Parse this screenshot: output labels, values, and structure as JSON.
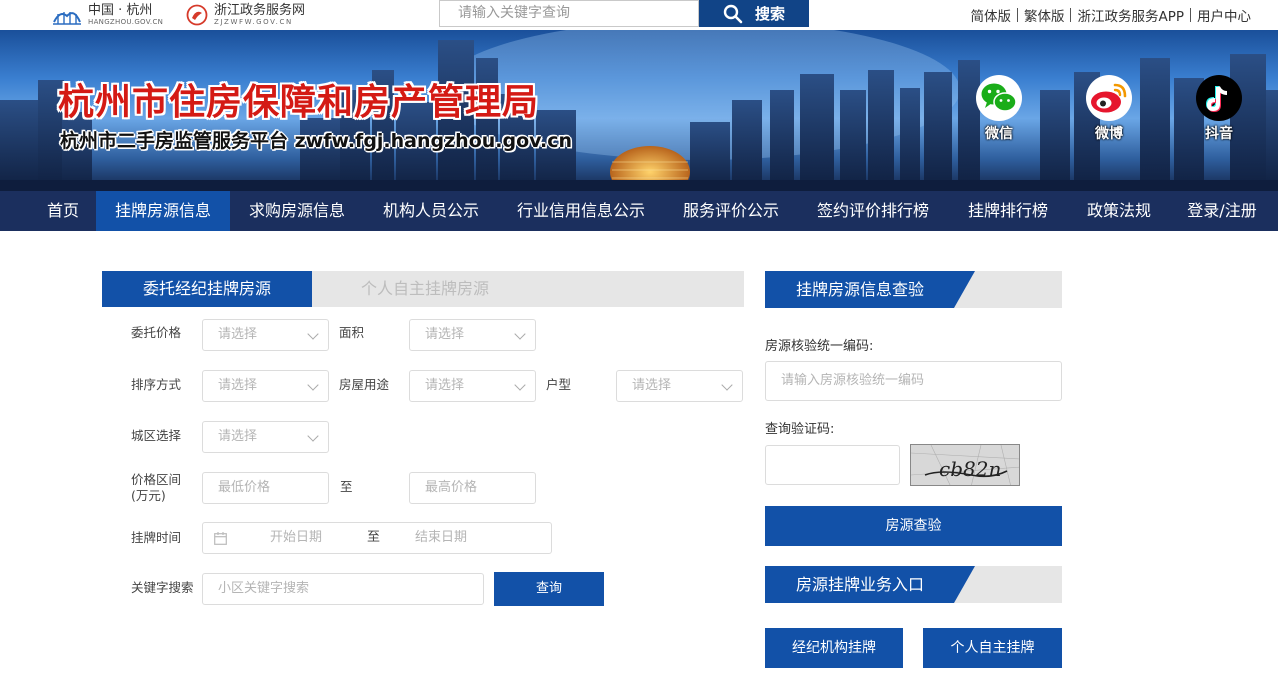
{
  "topbar": {
    "logo_cn_name": "中国 · 杭州",
    "logo_cn_domain": "HANGZHOU.GOV.CN",
    "logo_zj_name": "浙江政务服务网",
    "logo_zj_domain": "ZJZWFW.GOV.CN",
    "search_placeholder": "请输入关键字查询",
    "search_button": "搜索",
    "links": [
      "简体版",
      "繁体版",
      "浙江政务服务APP",
      "用户中心"
    ]
  },
  "banner": {
    "title": "杭州市住房保障和房产管理局",
    "subtitle": "杭州市二手房监管服务平台 zwfw.fgj.hangzhou.gov.cn",
    "social": [
      {
        "label": "微信",
        "icon": "wechat-icon",
        "color": "#1aad19"
      },
      {
        "label": "微博",
        "icon": "weibo-icon",
        "color": "#e6162d"
      },
      {
        "label": "抖音",
        "icon": "douyin-icon",
        "color": "#000000"
      }
    ]
  },
  "nav": {
    "items": [
      "首页",
      "挂牌房源信息",
      "求购房源信息",
      "机构人员公示",
      "行业信用信息公示",
      "服务评价公示",
      "签约评价排行榜",
      "挂牌排行榜",
      "政策法规",
      "登录/注册"
    ],
    "active": "挂牌房源信息"
  },
  "listing_tabs": {
    "agency": "委托经纪挂牌房源",
    "personal": "个人自主挂牌房源"
  },
  "filters": {
    "price_label": "委托价格",
    "area_label": "面积",
    "sort_label": "排序方式",
    "usage_label": "房屋用途",
    "layout_label": "户型",
    "district_label": "城区选择",
    "select_placeholder": "请选择",
    "price_range_label": "价格区间",
    "price_range_unit": "(万元)",
    "min_price_placeholder": "最低价格",
    "max_price_placeholder": "最高价格",
    "to": "至",
    "listing_time_label": "挂牌时间",
    "start_date_placeholder": "开始日期",
    "end_date_placeholder": "结束日期",
    "keyword_label": "关键字搜索",
    "keyword_placeholder": "小区关键字搜索",
    "query_button": "查询"
  },
  "verify": {
    "header": "挂牌房源信息查验",
    "code_label": "房源核验统一编码:",
    "code_placeholder": "请输入房源核验统一编码",
    "captcha_label": "查询验证码:",
    "captcha_text": "cb82n",
    "submit_button": "房源查验"
  },
  "entry": {
    "header": "房源挂牌业务入口",
    "agency_button": "经纪机构挂牌",
    "personal_button": "个人自主挂牌"
  },
  "colors": {
    "primary": "#1251a8",
    "nav_bg": "#1b2f5e",
    "title_red": "#d41a14"
  }
}
